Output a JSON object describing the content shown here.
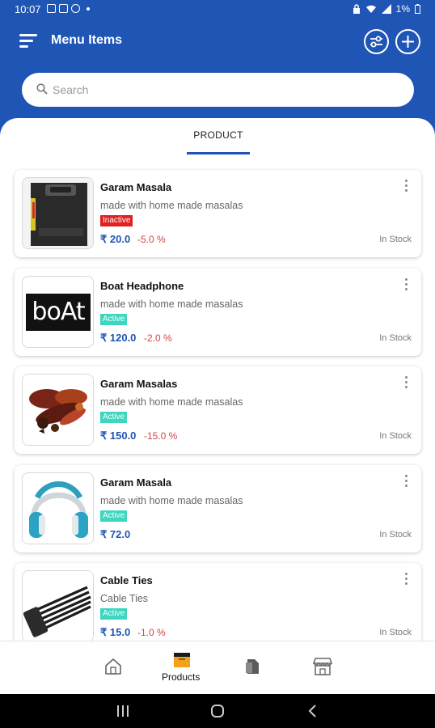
{
  "status_bar": {
    "time": "10:07",
    "battery": "1%"
  },
  "app_bar": {
    "title": "Menu Items"
  },
  "search": {
    "placeholder": "Search"
  },
  "tabs": [
    {
      "label": "PRODUCT"
    }
  ],
  "colors": {
    "primary": "#1f55b5",
    "inactive": "#e02020",
    "active": "#3ed6bf",
    "discount": "#d64545"
  },
  "products": [
    {
      "name": "Garam Masala",
      "description": "made with home made masalas",
      "status": "Inactive",
      "price": "₹ 20.0",
      "discount": "-5.0 %",
      "stock": "In Stock",
      "image": "bag-photo"
    },
    {
      "name": "Boat Headphone",
      "description": "made with home made masalas",
      "status": "Active",
      "price": "₹ 120.0",
      "discount": "-2.0 %",
      "stock": "In Stock",
      "image": "boat-logo",
      "image_text": "boAt"
    },
    {
      "name": "Garam Masalas",
      "description": "made with home made masalas",
      "status": "Active",
      "price": "₹ 150.0",
      "discount": "-15.0 %",
      "stock": "In Stock",
      "image": "spices-photo"
    },
    {
      "name": "Garam Masala",
      "description": "made with home made masalas",
      "status": "Active",
      "price": "₹ 72.0",
      "discount": "",
      "stock": "In Stock",
      "image": "headphones-photo"
    },
    {
      "name": "Cable Ties",
      "description": "Cable Ties",
      "status": "Active",
      "price": "₹ 15.0",
      "discount": "-1.0 %",
      "stock": "In Stock",
      "image": "cable-ties-photo"
    }
  ],
  "bottom_nav": {
    "items": [
      {
        "icon": "home-icon",
        "label": ""
      },
      {
        "icon": "products-box-icon",
        "label": "Products"
      },
      {
        "icon": "orders-bag-icon",
        "label": ""
      },
      {
        "icon": "store-icon",
        "label": ""
      }
    ]
  }
}
